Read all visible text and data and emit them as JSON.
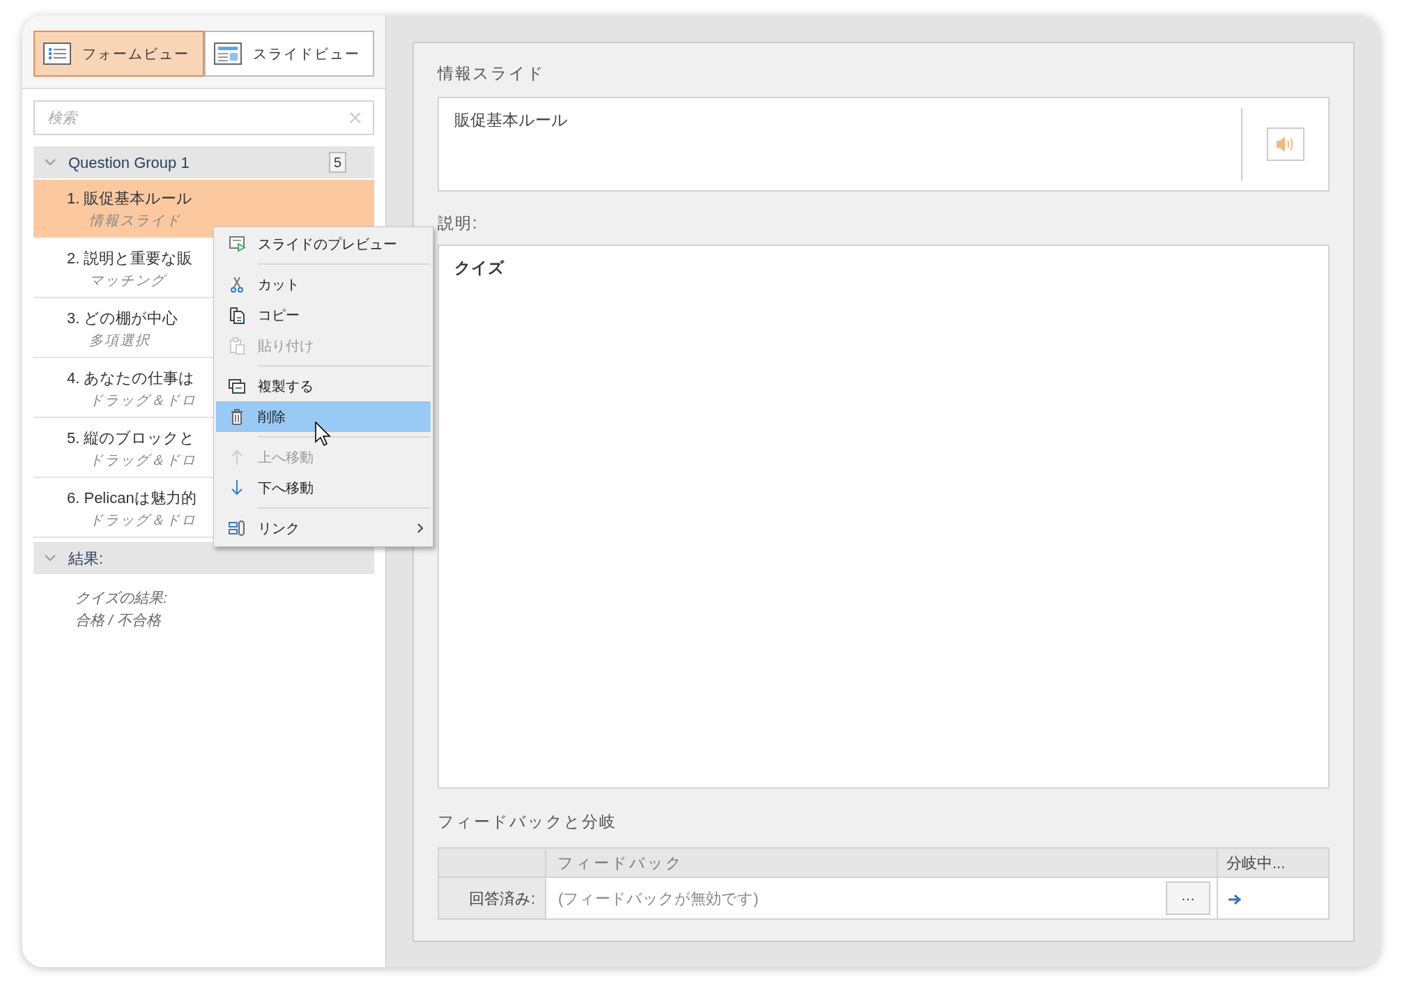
{
  "view_tabs": [
    {
      "label": "フォームビュー",
      "selected": true
    },
    {
      "label": "スライドビュー",
      "selected": false
    }
  ],
  "search": {
    "placeholder": "検索"
  },
  "outline": [
    {
      "label": "Question Group 1",
      "expanded": true,
      "count": "5",
      "children": [
        {
          "number": "1.",
          "title": "販促基本ルール",
          "type": "情報スライド",
          "selected": true
        },
        {
          "number": "2.",
          "title": "説明と重要な販",
          "type": "マッチング",
          "selected": false
        },
        {
          "number": "3.",
          "title": "どの棚が中心",
          "type": "多項選択",
          "selected": false
        },
        {
          "number": "4.",
          "title": "あなたの仕事は",
          "type": "ドラッグ＆ドロ",
          "selected": false
        },
        {
          "number": "5.",
          "title": "縦のブロックと",
          "type": "ドラッグ＆ドロ",
          "selected": false
        },
        {
          "number": "6.",
          "title": "Pelicanは魅力的",
          "type": "ドラッグ＆ドロ",
          "selected": false
        }
      ]
    },
    {
      "label": "結果:",
      "expanded": true,
      "children": [
        {
          "title": "クイズの結果:",
          "type": "合格 / 不合格",
          "selected": false
        }
      ]
    }
  ],
  "context_menu": [
    {
      "kind": "item",
      "label": "スライドのプレビュー",
      "disabled": false,
      "selected": false,
      "submenu": false
    },
    {
      "kind": "separator"
    },
    {
      "kind": "item",
      "label": "カット",
      "disabled": false,
      "selected": false,
      "submenu": false
    },
    {
      "kind": "item",
      "label": "コピー",
      "disabled": false,
      "selected": false,
      "submenu": false
    },
    {
      "kind": "item",
      "label": "貼り付け",
      "disabled": true,
      "selected": false,
      "submenu": false
    },
    {
      "kind": "separator"
    },
    {
      "kind": "item",
      "label": "複製する",
      "disabled": false,
      "selected": false,
      "submenu": false
    },
    {
      "kind": "item",
      "label": "削除",
      "disabled": false,
      "selected": true,
      "submenu": false
    },
    {
      "kind": "separator"
    },
    {
      "kind": "item",
      "label": "上へ移動",
      "disabled": true,
      "selected": false,
      "submenu": false
    },
    {
      "kind": "item",
      "label": "下へ移動",
      "disabled": false,
      "selected": false,
      "submenu": false
    },
    {
      "kind": "separator"
    },
    {
      "kind": "item",
      "label": "リンク",
      "disabled": false,
      "selected": false,
      "submenu": true
    }
  ],
  "slide": {
    "type_label": "情報スライド",
    "title": "販促基本ルール",
    "description_label": "説明:",
    "description": "クイズ"
  },
  "feedback": {
    "heading": "フィードバックと分岐",
    "columns": [
      "フィードバック",
      "分岐中..."
    ],
    "rows": [
      {
        "label": "回答済み:",
        "feedback": "(フィードバックが無効です)",
        "more": "···"
      }
    ]
  }
}
